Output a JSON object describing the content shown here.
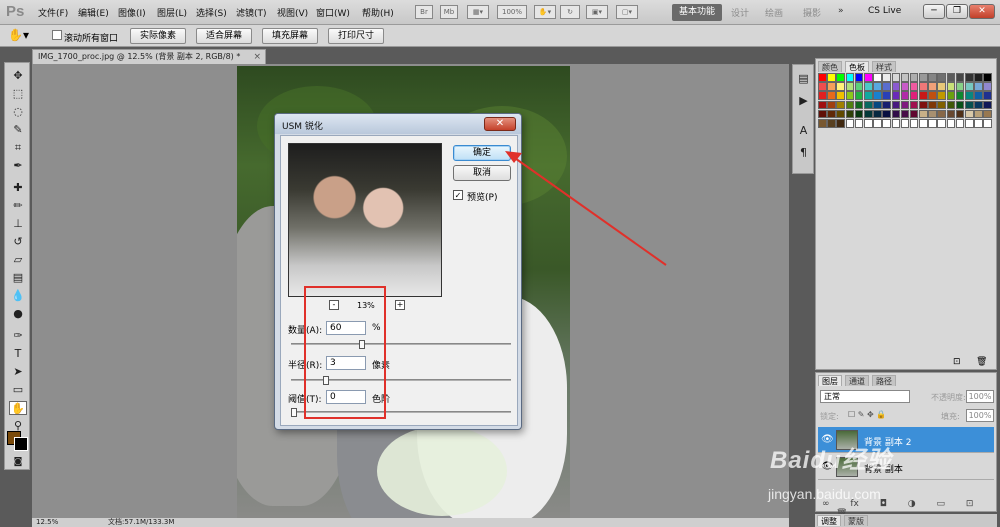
{
  "menubar": {
    "logo": "Ps",
    "items": [
      "文件(F)",
      "编辑(E)",
      "图像(I)",
      "图层(L)",
      "选择(S)",
      "滤镜(T)",
      "视图(V)",
      "窗口(W)",
      "帮助(H)"
    ],
    "zoom_box": "100%",
    "workspaces": {
      "active": "基本功能",
      "others": [
        "设计",
        "绘画",
        "摄影"
      ]
    },
    "cs_live": "CS Live",
    "more": "»"
  },
  "options_bar": {
    "scroll_all_label": "滚动所有窗口",
    "buttons": [
      "实际像素",
      "适合屏幕",
      "填充屏幕",
      "打印尺寸"
    ]
  },
  "document": {
    "tab_label": "IMG_1700_proc.jpg @ 12.5% (背景 副本 2, RGB/8) *",
    "tab_close": "×"
  },
  "status_bar": {
    "zoom": "12.5%",
    "doc_size": "文档:57.1M/133.3M"
  },
  "dialog": {
    "title": "USM 锐化",
    "ok_label": "确定",
    "cancel_label": "取消",
    "preview_label": "预览(P)",
    "preview_checked": true,
    "zoom_minus": "-",
    "zoom_plus": "+",
    "zoom_percent": "13%",
    "amount": {
      "label": "数量(A):",
      "value": "60",
      "unit": "%",
      "slider_fraction": 0.32
    },
    "radius": {
      "label": "半径(R):",
      "value": "3",
      "unit": "像素",
      "slider_fraction": 0.15
    },
    "threshold": {
      "label": "阈值(T):",
      "value": "0",
      "unit": "色阶",
      "slider_fraction": 0.0
    }
  },
  "swatches_panel": {
    "tabs": [
      "颜色",
      "色板",
      "样式"
    ],
    "active_tab": "色板"
  },
  "layers_panel": {
    "tabs": [
      "图层",
      "通道",
      "路径"
    ],
    "blend_mode": "正常",
    "opacity_label": "不透明度:",
    "opacity_value": "100%",
    "lock_label": "锁定:",
    "fill_label": "填充:",
    "fill_value": "100%",
    "layers": [
      {
        "name": "背景 副本 2",
        "selected": true
      },
      {
        "name": "背景 副本",
        "selected": false
      }
    ]
  },
  "bottom_tabs": [
    "调整",
    "蒙版"
  ],
  "watermark": {
    "logo": "Baidu经验",
    "url": "jingyan.baidu.com"
  },
  "colors": {
    "annotation_red": "#e0302a",
    "foreground": "#7a4a0a",
    "background": "#000000",
    "selected_layer": "#3c8fd8"
  }
}
